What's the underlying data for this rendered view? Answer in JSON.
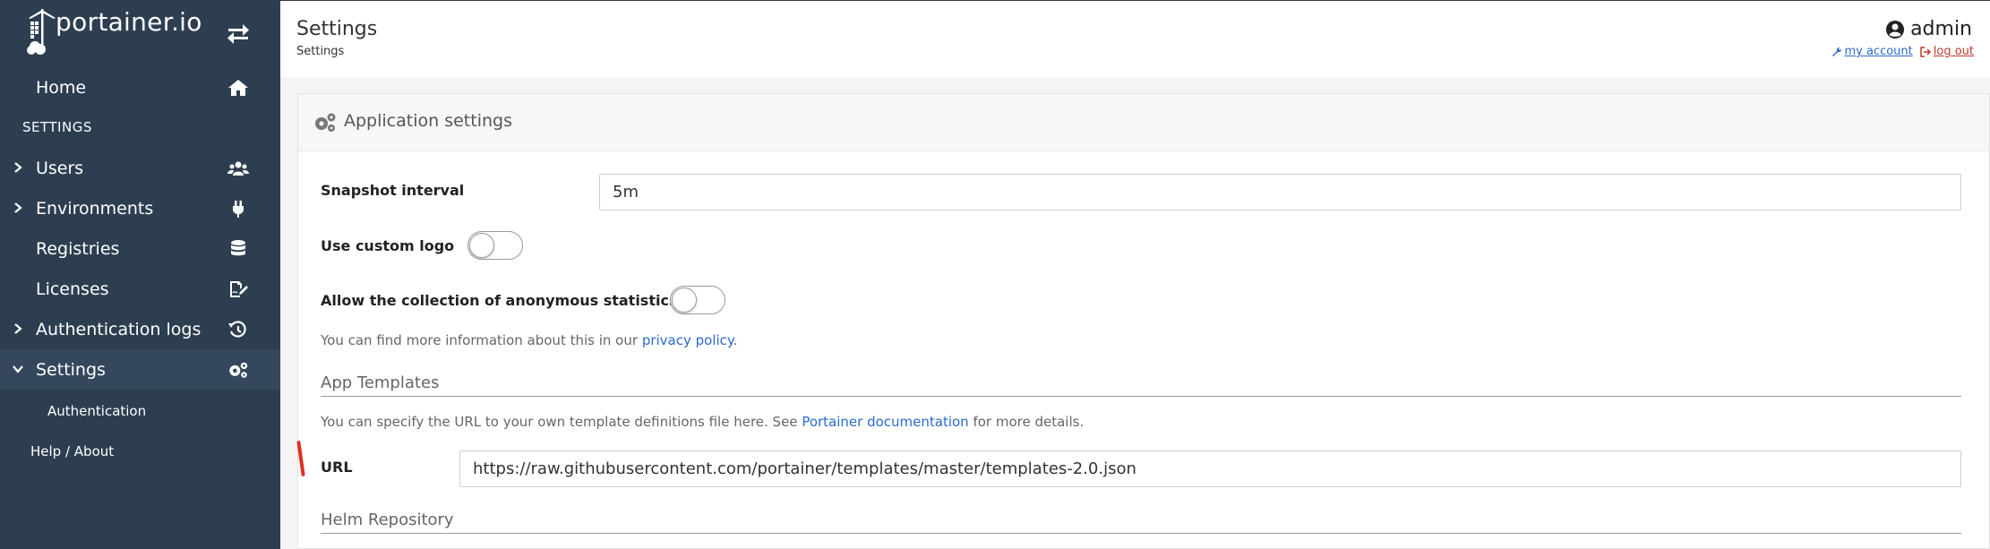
{
  "sidebar": {
    "logo_text": "portainer.io",
    "home_label": "Home",
    "section_label": "SETTINGS",
    "items": [
      {
        "label": "Users"
      },
      {
        "label": "Environments"
      },
      {
        "label": "Registries"
      },
      {
        "label": "Licenses"
      },
      {
        "label": "Authentication logs"
      },
      {
        "label": "Settings"
      }
    ],
    "sub_items": [
      {
        "label": "Authentication"
      }
    ],
    "help_label": "Help / About"
  },
  "header": {
    "title": "Settings",
    "breadcrumb": "Settings",
    "user": "admin",
    "my_account": "my account",
    "log_out": "log out"
  },
  "panel": {
    "title": "Application settings",
    "snapshot_label": "Snapshot interval",
    "snapshot_value": "5m",
    "custom_logo_label": "Use custom logo",
    "anon_stats_label": "Allow the collection of anonymous statistics",
    "privacy_prefix": "You can find more information about this in our",
    "privacy_link": "privacy policy",
    "privacy_suffix": ".",
    "app_templates_title": "App Templates",
    "templates_help_prefix": "You can specify the URL to your own template definitions file here. See",
    "templates_help_link": "Portainer documentation",
    "templates_help_suffix": "for more details.",
    "url_label": "URL",
    "url_value": "https://raw.githubusercontent.com/portainer/templates/master/templates-2.0.json",
    "helm_title": "Helm Repository"
  },
  "colors": {
    "sidebar_bg": "#2d3e50",
    "sidebar_active": "#34475c",
    "link_blue": "#2a6ad1",
    "logout_red": "#c0392b"
  }
}
